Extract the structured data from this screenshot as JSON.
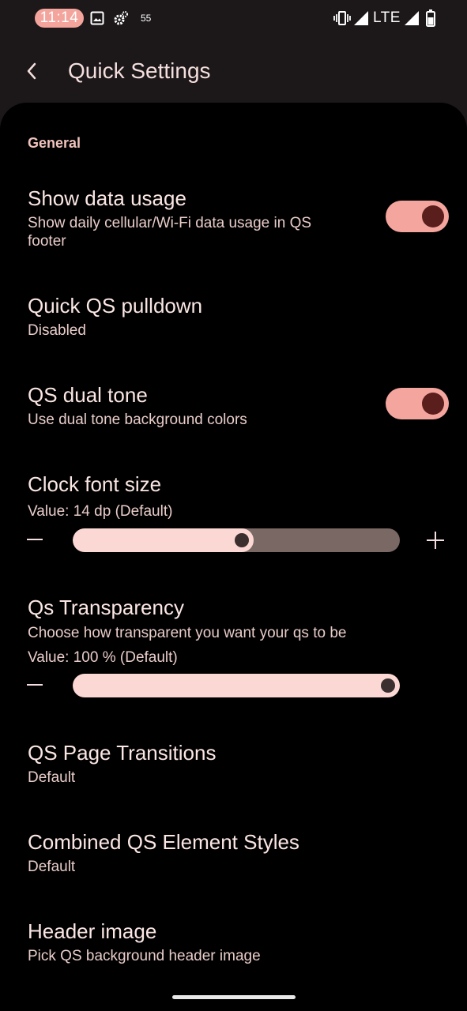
{
  "status_bar": {
    "time": "11:14",
    "notification_count": "55",
    "network": "LTE",
    "icons": [
      "gallery-icon",
      "settings-gear-icon",
      "vibrate-icon",
      "signal-icon",
      "signal-icon",
      "battery-icon"
    ]
  },
  "app_bar": {
    "title": "Quick Settings",
    "back_icon": "chevron-left-icon"
  },
  "section": {
    "label": "General"
  },
  "prefs": {
    "data_usage": {
      "title": "Show data usage",
      "subtitle": "Show daily cellular/Wi-Fi data usage in QS footer",
      "enabled": true
    },
    "quick_pulldown": {
      "title": "Quick QS pulldown",
      "subtitle": "Disabled"
    },
    "dual_tone": {
      "title": "QS dual tone",
      "subtitle": "Use dual tone background colors",
      "enabled": true
    },
    "clock_font": {
      "title": "Clock font size",
      "value_text": "Value: 14 dp (Default)",
      "level": 0.52
    },
    "transparency": {
      "title": "Qs Transparency",
      "subtitle": "Choose how transparent you want your qs to be",
      "value_text": "Value: 100 % (Default)",
      "level": 1.0
    },
    "page_transitions": {
      "title": "QS Page Transitions",
      "subtitle": "Default"
    },
    "element_styles": {
      "title": "Combined QS Element Styles",
      "subtitle": "Default"
    },
    "header_image": {
      "title": "Header image",
      "subtitle": "Pick QS background header image"
    }
  },
  "colors": {
    "accent": "#f4a69e",
    "thumb": "#5a1e1c",
    "slider_fill": "#fcd8d4",
    "slider_track": "#7a6865",
    "background": "#000000"
  }
}
